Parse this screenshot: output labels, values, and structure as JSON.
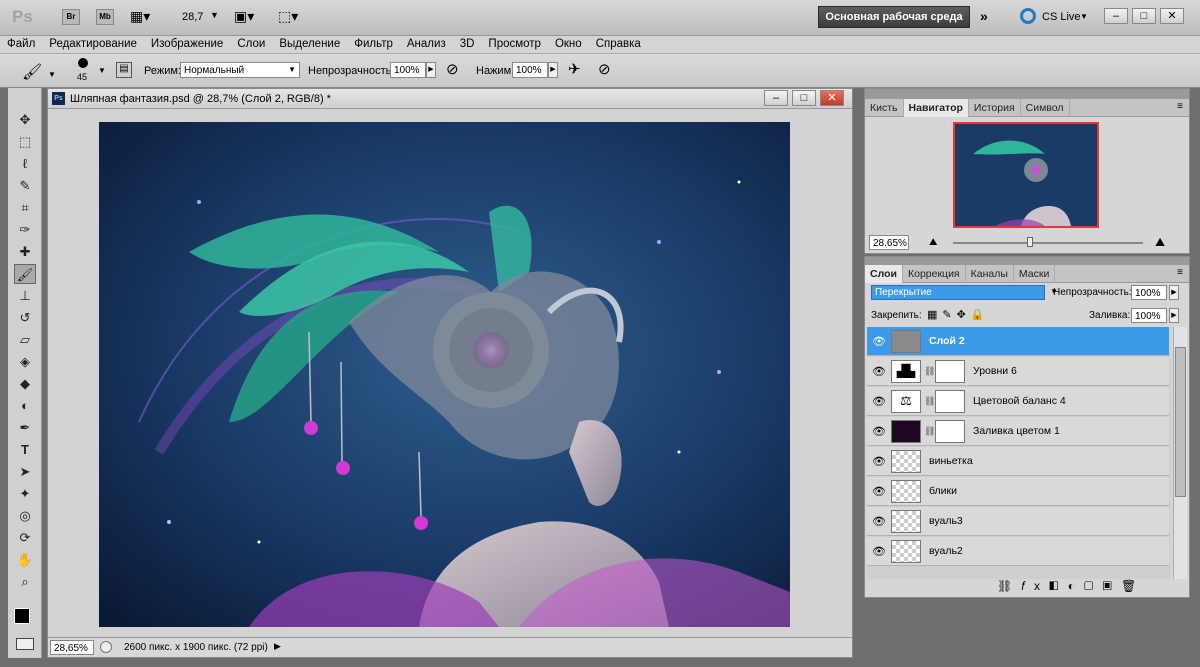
{
  "app": {
    "logo": "Ps",
    "bridge": "Br",
    "minibridge": "Mb",
    "zoom": "28,7",
    "workspace": "Основная рабочая среда",
    "cslive": "CS Live"
  },
  "menu": [
    "Файл",
    "Редактирование",
    "Изображение",
    "Слои",
    "Выделение",
    "Фильтр",
    "Анализ",
    "3D",
    "Просмотр",
    "Окно",
    "Справка"
  ],
  "options": {
    "brush_size": "45",
    "mode_label": "Режим:",
    "mode_value": "Нормальный",
    "opacity_label": "Непрозрачность:",
    "opacity_value": "100%",
    "flow_label": "Нажим:",
    "flow_value": "100%"
  },
  "document": {
    "title": "Шляпная фантазия.psd @ 28,7% (Слой 2, RGB/8) *",
    "zoom": "28,65%",
    "info": "2600 пикс. x 1900 пикс. (72 ppi)"
  },
  "navigator": {
    "tabs": [
      "Кисть",
      "Навигатор",
      "История",
      "Символ"
    ],
    "active_tab": 1,
    "zoom": "28.65%"
  },
  "layers_panel": {
    "tabs": [
      "Слои",
      "Коррекция",
      "Каналы",
      "Маски"
    ],
    "active_tab": 0,
    "blend_mode": "Перекрытие",
    "opacity_label": "Непрозрачность:",
    "opacity_value": "100%",
    "lock_label": "Закрепить:",
    "fill_label": "Заливка:",
    "fill_value": "100%",
    "layers": [
      {
        "name": "Слой 2",
        "type": "gray",
        "selected": true
      },
      {
        "name": "Уровни 6",
        "type": "levels",
        "mask": true
      },
      {
        "name": "Цветовой баланс 4",
        "type": "balance",
        "mask": true
      },
      {
        "name": "Заливка цветом 1",
        "type": "fill",
        "mask": true
      },
      {
        "name": "виньетка",
        "type": "transparent"
      },
      {
        "name": "блики",
        "type": "transparent"
      },
      {
        "name": "вуаль3",
        "type": "transparent"
      },
      {
        "name": "вуаль2",
        "type": "transparent"
      }
    ]
  },
  "colors": {
    "accent": "#3d9ae8",
    "canvas_bg": "#1d3d6a",
    "feather": "#2fb59a",
    "jewel": "#c43ad6"
  }
}
